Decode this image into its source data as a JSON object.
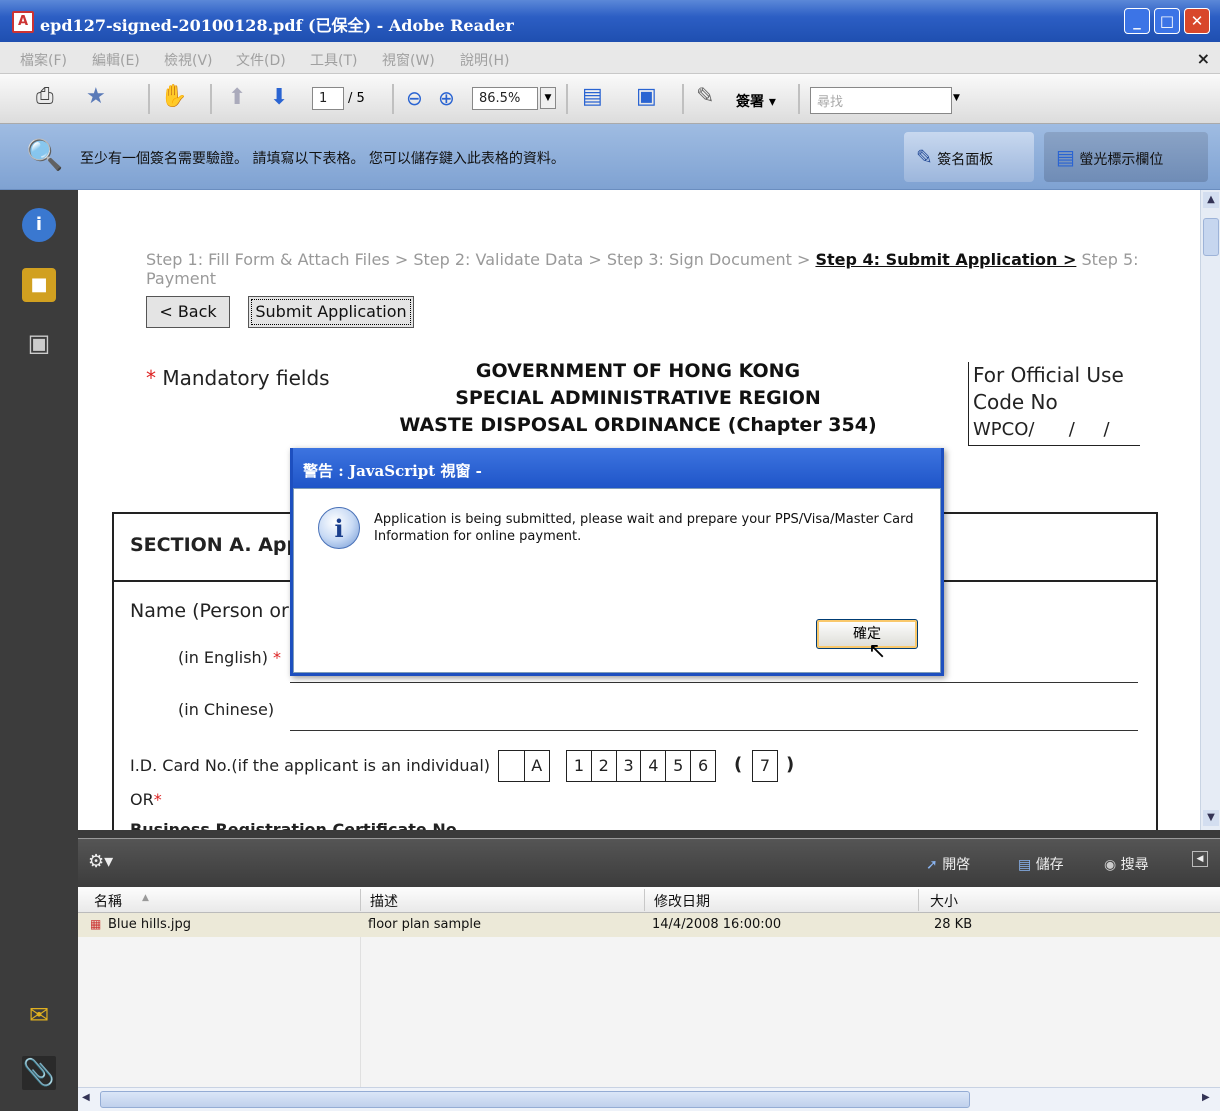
{
  "window": {
    "title": "epd127-signed-20100128.pdf (已保全) - Adobe Reader",
    "app_icon": "pdf-icon",
    "min": "_",
    "max": "□",
    "close": "✕"
  },
  "menu": [
    "檔案(F)",
    "編輯(E)",
    "檢視(V)",
    "文件(D)",
    "工具(T)",
    "視窗(W)",
    "說明(H)"
  ],
  "menu_close": "×",
  "toolbar": {
    "page_current": "1",
    "page_total": "/ 5",
    "zoom": "86.5%",
    "sign_label": "簽署 ▾",
    "search_placeholder": "尋找"
  },
  "message_bar": {
    "text": "至少有一個簽名需要驗證。 請填寫以下表格。 您可以儲存鍵入此表格的資料。",
    "sign_panel": "簽名面板",
    "highlight_fields": "螢光標示欄位"
  },
  "document": {
    "step1": "Step 1: Fill Form & Attach Files > Step 2: Validate Data > Step 3: Sign Document > ",
    "step4": "Step 4: Submit Application >",
    "step5": " Step 5: Payment",
    "back": "< Back",
    "submit": "Submit Application",
    "mandatory": "Mandatory fields",
    "asterisk": "*",
    "heading1": "GOVERNMENT OF HONG KONG",
    "heading2": "SPECIAL ADMINISTRATIVE REGION",
    "heading3": "WASTE DISPOSAL ORDINANCE (Chapter 354)",
    "official1": "For Official Use",
    "official2": "Code No",
    "official3": "WPCO/      /     /",
    "section_a": "SECTION A. Appl",
    "name_label": "Name (Person or",
    "in_english": "(in English)",
    "in_chinese": "(in Chinese)",
    "id_label": "I.D. Card No.(if the applicant is an individual)",
    "id_letters": [
      "",
      "A"
    ],
    "id_digits": [
      "1",
      "2",
      "3",
      "4",
      "5",
      "6"
    ],
    "id_check": "7",
    "paren_open": "(",
    "paren_close": ")",
    "or": "OR",
    "br_cert": "Business Registration Certificate No"
  },
  "dialog": {
    "title": "警告 : JavaScript 視窗 -",
    "message": "Application is being submitted, please wait and prepare your PPS/Visa/Master Card Information for online payment.",
    "ok": "確定"
  },
  "attachments": {
    "tool_open": "開啓",
    "tool_save": "儲存",
    "tool_search": "搜尋",
    "columns": [
      "名稱",
      "描述",
      "修改日期",
      "大小"
    ],
    "rows": [
      {
        "name": "Blue hills.jpg",
        "description": "floor plan sample",
        "modified": "14/4/2008 16:00:00",
        "size": "28 KB"
      }
    ]
  }
}
